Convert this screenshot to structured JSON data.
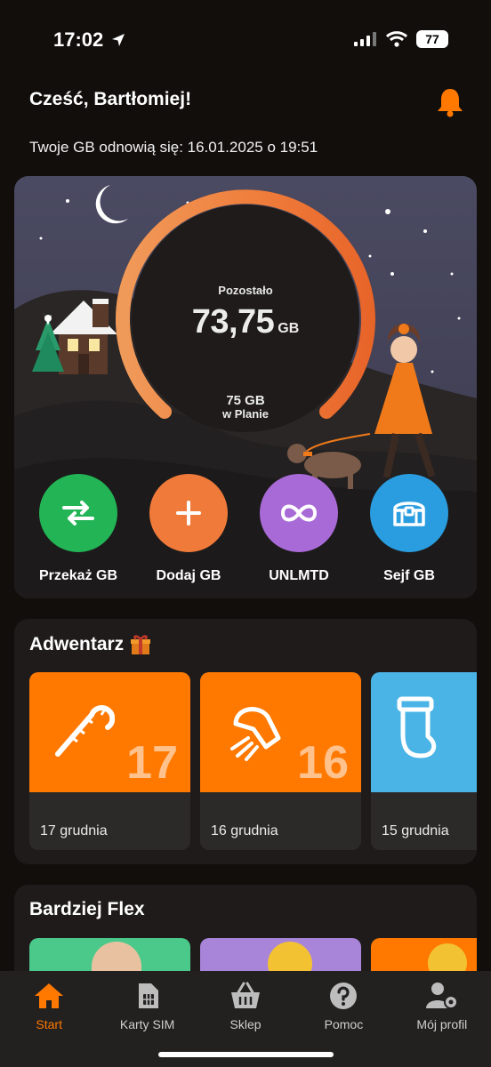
{
  "status": {
    "time": "17:02",
    "battery": "77"
  },
  "header": {
    "greeting": "Cześć, Bartłomiej!",
    "renewal": "Twoje GB odnowią się: 16.01.2025 o 19:51"
  },
  "gauge": {
    "label": "Pozostało",
    "value": "73,75",
    "unit": "GB",
    "plan_value": "75 GB",
    "plan_label": "w Planie",
    "remaining_fraction": 0.983
  },
  "actions": [
    {
      "label": "Przekaż GB",
      "icon": "transfer-icon",
      "color": "#1db954"
    },
    {
      "label": "Dodaj GB",
      "icon": "plus-icon",
      "color": "#f07a3a"
    },
    {
      "label": "UNLMTD",
      "icon": "infinity-icon",
      "color": "#a86ad6"
    },
    {
      "label": "Sejf GB",
      "icon": "vault-icon",
      "color": "#2a9de0"
    }
  ],
  "advent": {
    "title": "Adwentarz",
    "cards": [
      {
        "number": "17",
        "date": "17 grudnia",
        "icon": "candy-cane-icon",
        "color": "#ff7900"
      },
      {
        "number": "16",
        "date": "16 grudnia",
        "icon": "scarf-icon",
        "color": "#ff7900"
      },
      {
        "number": "",
        "date": "15 grudnia",
        "icon": "stocking-icon",
        "color": "#4bb4e6"
      }
    ]
  },
  "flex": {
    "title": "Bardziej Flex",
    "cards": [
      {
        "color": "#4bc98a"
      },
      {
        "color": "#a885d8"
      },
      {
        "color": "#ff7900"
      }
    ]
  },
  "tabs": [
    {
      "label": "Start",
      "icon": "home-icon",
      "active": true
    },
    {
      "label": "Karty SIM",
      "icon": "sim-card-icon",
      "active": false
    },
    {
      "label": "Sklep",
      "icon": "basket-icon",
      "active": false
    },
    {
      "label": "Pomoc",
      "icon": "help-icon",
      "active": false
    },
    {
      "label": "Mój profil",
      "icon": "profile-settings-icon",
      "active": false
    }
  ]
}
